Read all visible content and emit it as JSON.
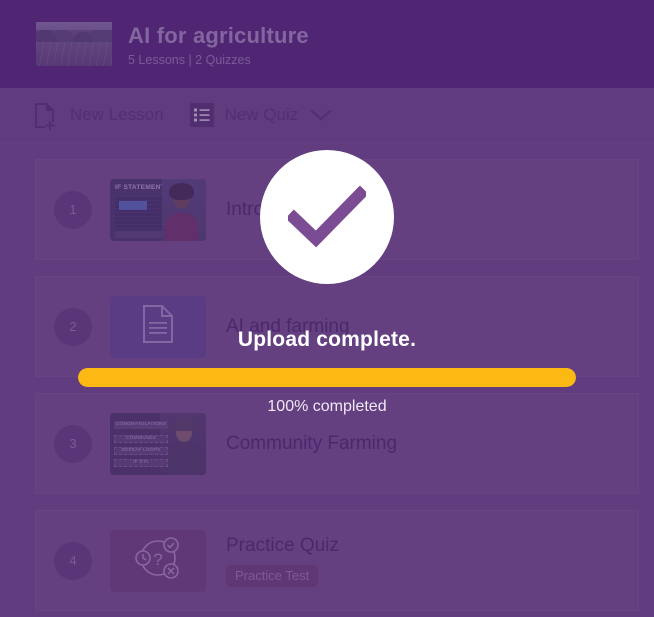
{
  "header": {
    "title": "AI for agriculture",
    "subtitle": "5 Lessons | 2 Quizzes",
    "thumb_alt": "course-cover-field-photo"
  },
  "toolbar": {
    "new_lesson_label": "New Lesson",
    "new_lesson_icon": "document-plus-icon",
    "new_quiz_label": "New Quiz",
    "new_quiz_icon": "list-icon",
    "chevron_icon": "chevron-down-icon"
  },
  "lessons": [
    {
      "number": "1",
      "title": "Introduction",
      "thumb_type": "video",
      "thumb_caption": "IF STATEMENTS",
      "badge": ""
    },
    {
      "number": "2",
      "title": "AI and farming",
      "thumb_type": "document",
      "thumb_caption": "",
      "badge": ""
    },
    {
      "number": "3",
      "title": "Community Farming",
      "thumb_type": "video-congrats",
      "thumb_caption": "CONGRATULATIONS",
      "thumb_lines": [
        "COMMANDS",
        "REPEAT LOOPS",
        "IF STA"
      ],
      "badge": ""
    },
    {
      "number": "4",
      "title": "Practice Quiz",
      "thumb_type": "quiz",
      "thumb_caption": "",
      "badge": "Practice Test"
    }
  ],
  "upload_modal": {
    "icon": "check-circle-icon",
    "title": "Upload complete.",
    "progress_percent": 100,
    "progress_label": "100% completed",
    "progress_color": "#fcb813"
  },
  "colors": {
    "header_bg": "#451770",
    "body_bg": "#6d4c87",
    "accent": "#fcb813",
    "overlay": "rgba(88,50,120,0.55)"
  }
}
